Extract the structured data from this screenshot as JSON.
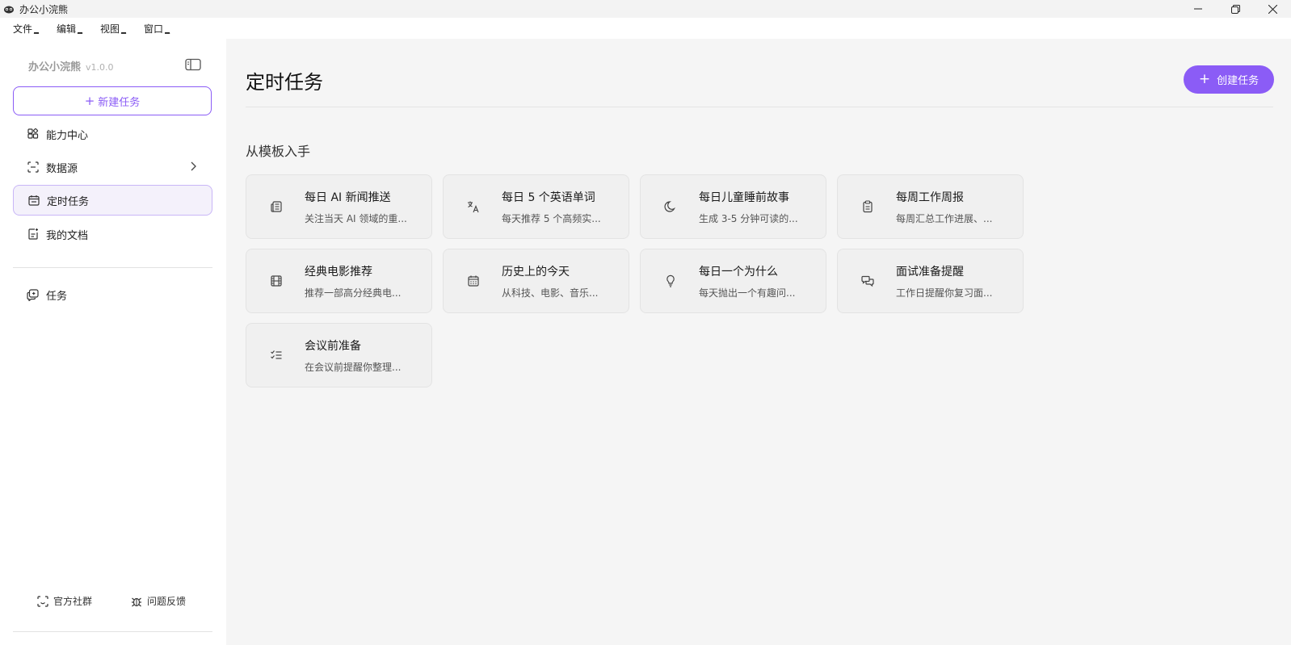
{
  "window": {
    "title": "办公小浣熊",
    "logo_icon": "raccoon-logo-icon",
    "controls": [
      "minimize-icon",
      "restore-icon",
      "close-icon"
    ]
  },
  "menubar": {
    "items": [
      {
        "label": "文件",
        "mnemonic": "_"
      },
      {
        "label": "编辑",
        "mnemonic": "_"
      },
      {
        "label": "视图",
        "mnemonic": "_"
      },
      {
        "label": "窗口",
        "mnemonic": "_"
      }
    ]
  },
  "sidebar": {
    "brand_name": "办公小浣熊",
    "version": "v1.0.0",
    "new_task_label": "新建任务",
    "items": [
      {
        "label": "能力中心",
        "icon": "capability-grid-icon"
      },
      {
        "label": "数据源",
        "icon": "datasource-icon"
      },
      {
        "label": "定时任务",
        "icon": "calendar-icon",
        "active": true
      },
      {
        "label": "我的文档",
        "icon": "document-icon"
      },
      {
        "label": "任务",
        "icon": "task-chat-icon"
      }
    ],
    "footer": {
      "community_label": "官方社群",
      "feedback_label": "问题反馈"
    }
  },
  "main": {
    "title": "定时任务",
    "create_label": "创建任务",
    "section_title": "从模板入手",
    "accent_color": "#8b5cf6",
    "templates": [
      {
        "title": "每日 AI 新闻推送",
        "desc": "关注当天 AI 领域的重...",
        "icon": "newspaper-icon"
      },
      {
        "title": "每日 5 个英语单词",
        "desc": "每天推荐 5 个高频实...",
        "icon": "translate-icon"
      },
      {
        "title": "每日儿童睡前故事",
        "desc": "生成 3-5 分钟可读的...",
        "icon": "moon-icon"
      },
      {
        "title": "每周工作周报",
        "desc": "每周汇总工作进展、...",
        "icon": "clipboard-icon"
      },
      {
        "title": "经典电影推荐",
        "desc": "推荐一部高分经典电...",
        "icon": "film-icon"
      },
      {
        "title": "历史上的今天",
        "desc": "从科技、电影、音乐...",
        "icon": "calendar-icon"
      },
      {
        "title": "每日一个为什么",
        "desc": "每天抛出一个有趣问...",
        "icon": "lightbulb-icon"
      },
      {
        "title": "面试准备提醒",
        "desc": "工作日提醒你复习面...",
        "icon": "chat-bubbles-icon"
      },
      {
        "title": "会议前准备",
        "desc": "在会议前提醒你整理...",
        "icon": "checklist-icon"
      }
    ]
  }
}
